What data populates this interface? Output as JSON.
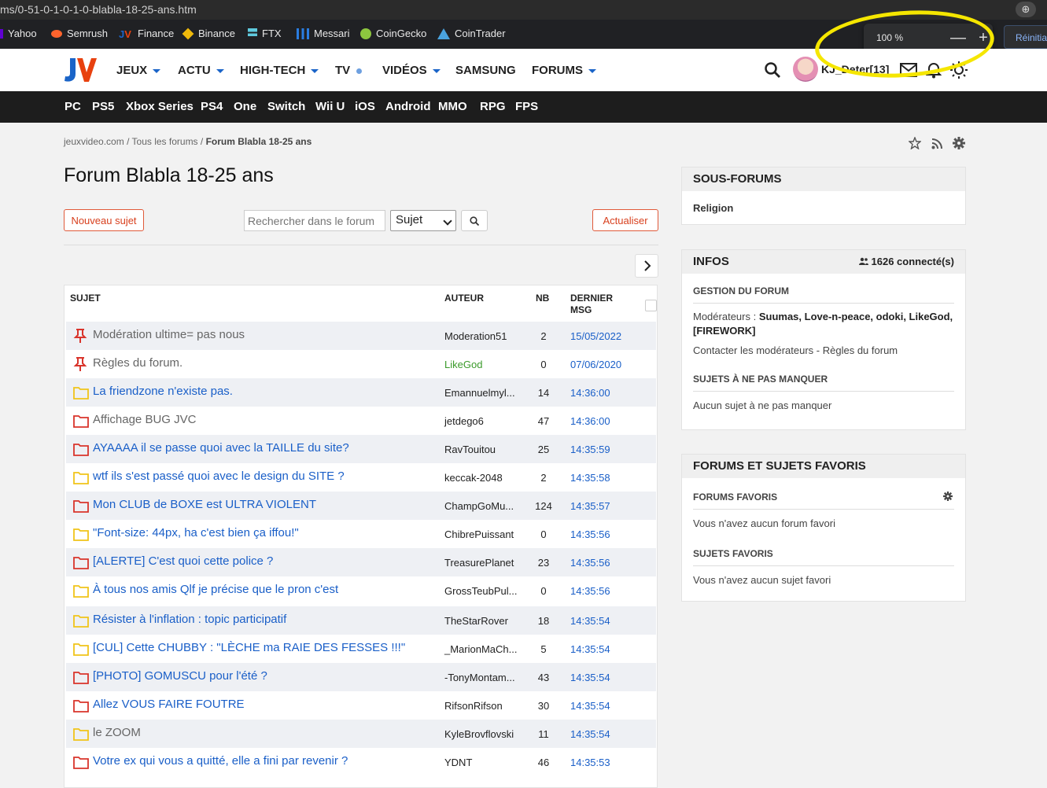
{
  "browser": {
    "url": "ms/0-51-0-1-0-1-0-blabla-18-25-ans.htm",
    "bookmarks": [
      "Yahoo",
      "Semrush",
      "Finance",
      "Binance",
      "FTX",
      "Messari",
      "CoinGecko",
      "CoinTrader"
    ],
    "zoom_level": "100 %",
    "zoom_minus": "—",
    "zoom_plus": "+",
    "reset_label": "Réinitia",
    "highlight_color": "#f5e600"
  },
  "header": {
    "nav": [
      "JEUX",
      "ACTU",
      "HIGH-TECH",
      "TV",
      "VIDÉOS",
      "SAMSUNG",
      "FORUMS"
    ],
    "username": "KJ_Deter[13]",
    "platforms": [
      "PC",
      "PS5",
      "Xbox Series",
      "PS4",
      "One",
      "Switch",
      "Wii U",
      "iOS",
      "Android",
      "MMO",
      "RPG",
      "FPS"
    ]
  },
  "breadcrumb": {
    "home": "jeuxvideo.com",
    "sep": "/",
    "all_forums": "Tous les forums",
    "current": "Forum Blabla 18-25 ans"
  },
  "forum": {
    "title": "Forum Blabla 18-25 ans",
    "new_topic": "Nouveau sujet",
    "search_placeholder": "Rechercher dans le forum",
    "search_scope": "Sujet",
    "refresh": "Actualiser",
    "columns": {
      "subject": "SUJET",
      "author": "AUTEUR",
      "nb": "NB",
      "last": "DERNIER MSG"
    },
    "topics": [
      {
        "icon": "pin-icon",
        "subject": "Modération ultime= pas nous",
        "author": "Moderation51",
        "nb": "2",
        "last": "15/05/2022"
      },
      {
        "icon": "pin-icon",
        "subject": "Règles du forum.",
        "author": "LikeGod",
        "nb": "0",
        "last": "07/06/2020"
      },
      {
        "icon": "folder-yellow-icon",
        "subject": "La friendzone n'existe pas.",
        "author": "Emannuelmyl...",
        "nb": "14",
        "last": "14:36:00"
      },
      {
        "icon": "folder-red-icon",
        "subject": "Affichage BUG JVC",
        "author": "jetdego6",
        "nb": "47",
        "last": "14:36:00"
      },
      {
        "icon": "folder-red-icon",
        "subject": "AYAAAA il se passe quoi avec la TAILLE du site?",
        "author": "RavTouitou",
        "nb": "25",
        "last": "14:35:59"
      },
      {
        "icon": "folder-yellow-icon",
        "subject": "wtf ils s'est passé quoi avec le design du SITE ?",
        "author": "keccak-2048",
        "nb": "2",
        "last": "14:35:58"
      },
      {
        "icon": "folder-red-icon",
        "subject": "Mon CLUB de BOXE est ULTRA VIOLENT",
        "author": "ChampGoMu...",
        "nb": "124",
        "last": "14:35:57"
      },
      {
        "icon": "folder-yellow-icon",
        "subject": "\"Font-size: 44px, ha c'est bien ça iffou!\"",
        "author": "ChibrePuissant",
        "nb": "0",
        "last": "14:35:56"
      },
      {
        "icon": "folder-red-icon",
        "subject": "[ALERTE] C'est quoi cette police ?",
        "author": "TreasurePlanet",
        "nb": "23",
        "last": "14:35:56"
      },
      {
        "icon": "folder-yellow-icon",
        "subject": "À tous nos amis Qlf je précise que le pron c'est",
        "author": "GrossTeubPul...",
        "nb": "0",
        "last": "14:35:56"
      },
      {
        "icon": "folder-yellow-icon",
        "subject": "Résister à l'inflation : topic participatif",
        "author": "TheStarRover",
        "nb": "18",
        "last": "14:35:54"
      },
      {
        "icon": "folder-yellow-icon",
        "subject": "[CUL] Cette CHUBBY : \"LÈCHE ma RAIE DES FESSES !!!\"",
        "author": "_MarionMaCh...",
        "nb": "5",
        "last": "14:35:54"
      },
      {
        "icon": "folder-red-icon",
        "subject": "[PHOTO] GOMUSCU pour l'été ?",
        "author": "-TonyMontam...",
        "nb": "43",
        "last": "14:35:54"
      },
      {
        "icon": "folder-red-icon",
        "subject": "Allez VOUS FAIRE FOUTRE",
        "author": "RifsonRifson",
        "nb": "30",
        "last": "14:35:54"
      },
      {
        "icon": "folder-yellow-icon",
        "subject": "le ZOOM",
        "author": "KyleBrovflovski",
        "nb": "11",
        "last": "14:35:54"
      },
      {
        "icon": "folder-red-icon",
        "subject": "Votre ex qui vous a quitté, elle a fini par revenir ?",
        "author": "YDNT",
        "nb": "46",
        "last": "14:35:53"
      }
    ]
  },
  "sidebar": {
    "subforums_title": "SOUS-FORUMS",
    "subforum": "Religion",
    "infos_title": "INFOS",
    "online": "1626 connecté(s)",
    "gestion_title": "GESTION DU FORUM",
    "moderators_label": "Modérateurs :",
    "moderators": "Suumas, Love-n-peace, odoki, LikeGod,",
    "moderators_line2": "[FIREWORK]",
    "contact": "Contacter les modérateurs",
    "contact_sep": " - ",
    "rules": "Règles du forum",
    "must_read_title": "SUJETS À NE PAS MANQUER",
    "must_read_empty": "Aucun sujet à ne pas manquer",
    "favorites_title": "FORUMS ET SUJETS FAVORIS",
    "fav_forums_title": "FORUMS FAVORIS",
    "fav_forums_empty": "Vous n'avez aucun forum favori",
    "fav_topics_title": "SUJETS FAVORIS",
    "fav_topics_empty": "Vous n'avez aucun sujet favori"
  },
  "colors": {
    "link": "#1a5fc8",
    "accent_red": "#d8401e",
    "folder_red": "#d9342b",
    "folder_yellow": "#f0c419",
    "pin": "#d9342b",
    "moderator": "#3a9a2a"
  }
}
